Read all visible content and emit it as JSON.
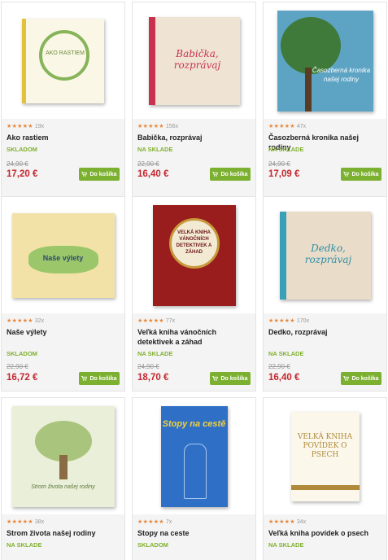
{
  "products": [
    {
      "title": "Ako rastiem",
      "reviews": "19x",
      "stock": "SKLADOM",
      "old_price": "24,90 €",
      "price": "17,20 €",
      "button": "Do košíka",
      "cover_text": "AKO RASTIEM"
    },
    {
      "title": "Babička, rozprávaj",
      "reviews": "156x",
      "stock": "NA SKLADE",
      "old_price": "22,90 €",
      "price": "16,40 €",
      "button": "Do košíka",
      "cover_text": "Babička, rozprávaj"
    },
    {
      "title": "Časozberná kronika našej rodiny",
      "reviews": "47x",
      "stock": "NA SKLADE",
      "old_price": "24,90 €",
      "price": "17,09 €",
      "button": "Do košíka",
      "cover_text": "Časozberná kronika našej rodiny"
    },
    {
      "title": "Naše výlety",
      "reviews": "32x",
      "stock": "SKLADOM",
      "old_price": "22,90 €",
      "price": "16,72 €",
      "button": "Do košíka",
      "cover_text": "Naše výlety"
    },
    {
      "title": "Veľká kniha vánočních detektivek a záhad",
      "reviews": "77x",
      "stock": "NA SKLADE",
      "old_price": "24,90 €",
      "price": "18,70 €",
      "button": "Do košíka",
      "cover_text": "VELKÁ KNIHA VÁNOČNÍCH DETEKTIVEK A ZÁHAD"
    },
    {
      "title": "Dedko, rozprávaj",
      "reviews": "170x",
      "stock": "NA SKLADE",
      "old_price": "22,90 €",
      "price": "16,40 €",
      "button": "Do košíka",
      "cover_text": "Dedko, rozprávaj"
    },
    {
      "title": "Strom života našej rodiny",
      "reviews": "38x",
      "stock": "NA SKLADE",
      "old_price": "",
      "price": "",
      "button": "",
      "cover_text": "Strom života našej rodiny"
    },
    {
      "title": "Stopy na ceste",
      "reviews": "7x",
      "stock": "SKLADOM",
      "old_price": "",
      "price": "",
      "button": "",
      "cover_text": "Stopy na cestě"
    },
    {
      "title": "Veľká kniha povídek o psech",
      "reviews": "34x",
      "stock": "NA SKLADE",
      "old_price": "",
      "price": "",
      "button": "",
      "cover_text": "VELKÁ KNIHA POVÍDEK O PSECH"
    }
  ],
  "stars": "★★★★★",
  "colors": {
    "accent": "#7cb030",
    "price": "#c4262e",
    "stars": "#e8873a",
    "stock": "#7fb02d"
  }
}
